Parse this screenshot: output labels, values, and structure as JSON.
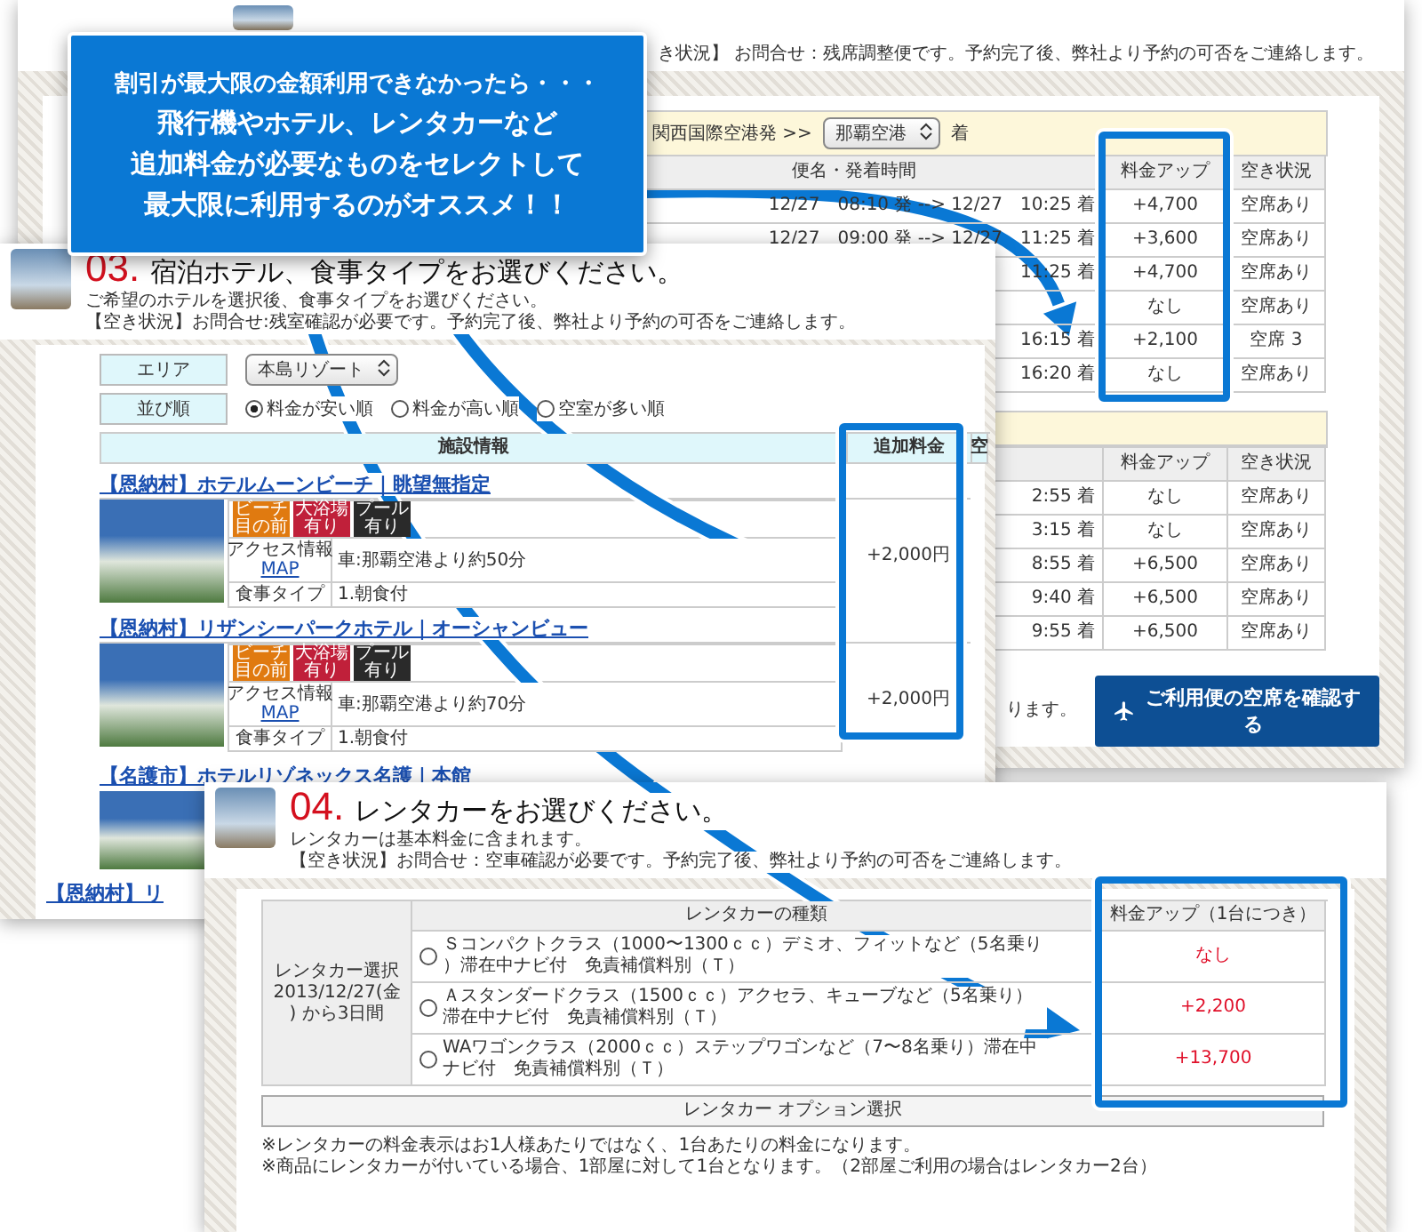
{
  "callout": {
    "lines": [
      "割引が最大限の金額利用できなかったら・・・",
      "飛行機やホテル、レンタカーなど",
      "追加料金が必要なものをセレクトして",
      "最大限に利用するのがオススメ！！"
    ]
  },
  "flight_panel": {
    "notice": "き状況】 お問合せ：残席調整便です。予約完了後、弊社より予約の可否をご連絡します。",
    "route": {
      "from": "関西国際空港発 >>",
      "select": "那覇空港",
      "to": "着"
    },
    "columns": [
      "便名・発着時間",
      "料金アップ",
      "空き状況"
    ],
    "rows": [
      {
        "time": "12/27　08:10 発 --> 12/27　10:25 着",
        "fare": "+4,700",
        "status": "空席あり"
      },
      {
        "time": "12/27　09:00 発 --> 12/27　11:25 着",
        "fare": "+3,600",
        "status": "空席あり"
      },
      {
        "time": "11:25 着",
        "fare": "+4,700",
        "status": "空席あり"
      },
      {
        "fare": "なし",
        "status": "空席あり"
      },
      {
        "time": "16:15 着",
        "fare": "+2,100",
        "status": "空席 3"
      },
      {
        "time": "16:20 着",
        "fare": "なし",
        "status": "空席あり"
      }
    ],
    "second_columns": [
      "料金アップ",
      "空き状況"
    ],
    "second_rows": [
      {
        "time": "2:55 着",
        "fare": "なし",
        "status": "空席あり"
      },
      {
        "time": "3:15 着",
        "fare": "なし",
        "status": "空席あり"
      },
      {
        "time": "8:55 着",
        "fare": "+6,500",
        "status": "空席あり"
      },
      {
        "time": "9:40 着",
        "fare": "+6,500",
        "status": "空席あり"
      },
      {
        "time": "9:55 着",
        "fare": "+6,500",
        "status": "空席あり"
      }
    ],
    "note": "ります。",
    "confirm_button": "ご利用便の空席を確認する"
  },
  "hotel_panel": {
    "number": "03.",
    "title": "宿泊ホテル、食事タイプをお選びください。",
    "subtitles": [
      "ご希望のホテルを選択後、食事タイプをお選びください。",
      "【空き状況】お問合せ:残室確認が必要です。予約完了後、弊社より予約の可否をご連絡します。"
    ],
    "area": {
      "label": "エリア",
      "select": "本島リゾート"
    },
    "sort": {
      "label": "並び順",
      "options": [
        {
          "label": "料金が安い順",
          "selected": true
        },
        {
          "label": "料金が高い順",
          "selected": false
        },
        {
          "label": "空室が多い順",
          "selected": false
        }
      ]
    },
    "columns": [
      "施設情報",
      "追加料金",
      "空"
    ],
    "hotels": [
      {
        "name": "【恩納村】ホテルムーンビーチ｜眺望無指定",
        "tags": [
          {
            "label": "ビーチ目の前",
            "color": "#e07a10"
          },
          {
            "label": "大浴場有り",
            "color": "#c0203a"
          },
          {
            "label": "プール有り",
            "color": "#2a2a2a"
          }
        ],
        "access_label": "アクセス情報",
        "map_link": "MAP",
        "access": "車:那覇空港より約50分",
        "meal_label": "食事タイプ",
        "meal": "1.朝食付",
        "fee": "+2,000円"
      },
      {
        "name": "【恩納村】リザンシーパークホテル｜オーシャンビュー",
        "tags": [
          {
            "label": "ビーチ目の前",
            "color": "#e07a10"
          },
          {
            "label": "大浴場有り",
            "color": "#c0203a"
          },
          {
            "label": "プール有り",
            "color": "#2a2a2a"
          }
        ],
        "access_label": "アクセス情報",
        "map_link": "MAP",
        "access": "車:那覇空港より約70分",
        "meal_label": "食事タイプ",
        "meal": "1.朝食付",
        "fee": "+2,000円"
      }
    ],
    "more_hotels": [
      "【名護市】ホテルリゾネックス名護｜本館",
      "【恩納村】リ"
    ]
  },
  "rental_panel": {
    "number": "04.",
    "title": "レンタカーをお選びください。",
    "subtitles": [
      "レンタカーは基本料金に含まれます。",
      "【空き状況】お問合せ：空車確認が必要です。予約完了後、弊社より予約の可否をご連絡します。"
    ],
    "row_label": "レンタカー選択 2013/12/27(金) から3日間",
    "columns": [
      "レンタカーの種類",
      "料金アップ（1台につき）"
    ],
    "cars": [
      {
        "label": "Ｓコンパクトクラス（1000〜1300ｃｃ）デミオ、フィットなど（5名乗り）滞在中ナビ付　免責補償料別（Ｔ）",
        "fare": "なし",
        "selected": false
      },
      {
        "label": "Ａスタンダードクラス（1500ｃｃ）アクセラ、キューブなど（5名乗り）滞在中ナビ付　免責補償料別（Ｔ）",
        "fare": "+2,200",
        "selected": false
      },
      {
        "label": "WAワゴンクラス（2000ｃｃ）ステップワゴンなど（7〜8名乗り）滞在中ナビ付　免責補償料別（Ｔ）",
        "fare": "+13,700",
        "selected": false
      }
    ],
    "option_button": "レンタカー オプション選択",
    "notes": [
      "※レンタカーの料金表示はお1人様あたりではなく、1台あたりの料金になります。",
      "※商品にレンタカーが付いている場合、1部屋に対して1台となります。（2部屋ご利用の場合はレンタカー2台）"
    ]
  }
}
